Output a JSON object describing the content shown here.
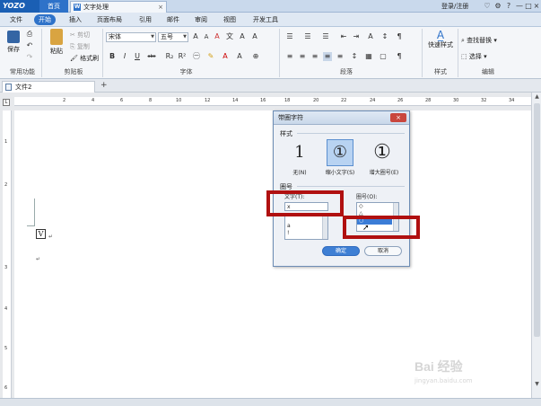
{
  "titlebar": {
    "logo": "YOZO",
    "home_tab": "首页",
    "doc_tab": "文字处理",
    "doc_tab_icon": "W",
    "doc_tab_close": "×",
    "login": "登录/注册",
    "controls": [
      "♡",
      "⚙",
      "?",
      "—",
      "□",
      "×"
    ]
  },
  "menu": {
    "items": [
      "文件",
      "开始",
      "插入",
      "页面布局",
      "引用",
      "邮件",
      "审阅",
      "视图",
      "开发工具"
    ],
    "active": "开始"
  },
  "ribbon": {
    "common": {
      "save": "保存",
      "group": "常用功能"
    },
    "clipboard": {
      "paste": "粘贴",
      "cut": "剪切",
      "copy": "复制",
      "format_painter": "格式刷",
      "group": "剪贴板"
    },
    "font": {
      "family": "宋体",
      "size": "五号",
      "grow": "A",
      "shrink": "A",
      "clear": "A",
      "bold": "B",
      "italic": "I",
      "underline": "U",
      "strike": "abc",
      "sub": "R₂",
      "sup": "R²",
      "enclose": "㊀",
      "group": "字体"
    },
    "paragraph": {
      "group": "段落"
    },
    "styles": {
      "quick": "快速样式",
      "group": "样式"
    },
    "editing": {
      "find_replace": "查找替换",
      "select": "选择",
      "group": "编辑"
    }
  },
  "tabs": {
    "file_tab": "文件2",
    "new_tab": "+"
  },
  "ruler": {
    "corner": "L",
    "h_ticks": [
      "2",
      "4",
      "6",
      "8",
      "10",
      "12",
      "14",
      "16",
      "18",
      "20",
      "22",
      "24",
      "26",
      "28",
      "30",
      "32",
      "34"
    ],
    "v_ticks": [
      "1",
      "2",
      "3",
      "4",
      "5",
      "6"
    ]
  },
  "document": {
    "enclosed_char": "V",
    "para_mark": "↵"
  },
  "dialog": {
    "title": "带圈字符",
    "close": "×",
    "style_section": "样式",
    "styles": [
      {
        "glyph": "1",
        "label": "无(N)"
      },
      {
        "glyph": "①",
        "label": "缩小文字(S)"
      },
      {
        "glyph": "①",
        "label": "增大圈号(E)"
      }
    ],
    "selected_style": "缩小文字(S)",
    "circle_section": "圈号",
    "text_label": "文字(T):",
    "text_value": "x",
    "text_list": [
      "a",
      "!"
    ],
    "circle_label": "圈号(O):",
    "circle_list": [
      "◇",
      "△",
      "○"
    ],
    "selected_circle": "○",
    "ok": "确定",
    "cancel": "取消"
  },
  "watermark": {
    "main": "Bai 经验",
    "sub": "jingyan.baidu.com"
  },
  "colors": {
    "accent": "#2e72c9",
    "annotation": "#b01010"
  }
}
